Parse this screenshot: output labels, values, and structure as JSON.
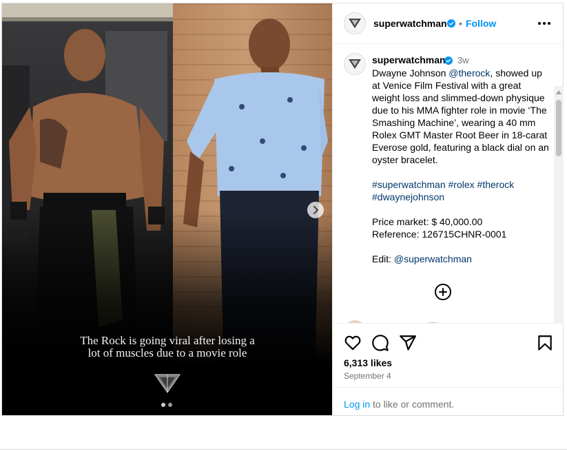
{
  "post": {
    "image_caption_lines": [
      "The Rock is going viral after losing a",
      "lot of muscles due to a movie role"
    ],
    "carousel": {
      "count": 2,
      "active_index": 0
    }
  },
  "header": {
    "username": "superwatchman",
    "separator": "•",
    "follow_label": "Follow"
  },
  "caption": {
    "username": "superwatchman",
    "time": "3w",
    "mention_therock": "@therock",
    "text_before_mention": "Dwayne Johnson ",
    "text_after_mention": ", showed up at Venice Film Festival with a great weight loss and slimmed-down physique due to his MMA fighter role in movie ‘The Smashing Machine’, wearing a 40 mm Rolex GMT Master Root Beer in 18-carat Everose gold, featuring a black dial on an oyster bracelet.",
    "hashtags": [
      "#superwatchman",
      "#rolex",
      "#therock",
      "#dwaynejohnson"
    ],
    "price_line": "Price market: $ 40,000.00",
    "reference_line": "Reference: 126715CHNR-0001",
    "edit_label": "Edit: ",
    "edit_mention": "@superwatchman"
  },
  "engagement": {
    "likes": "6,313 likes",
    "date": "September 4"
  },
  "login_prompt": {
    "link": "Log in",
    "rest": " to like or comment."
  },
  "colors": {
    "accent": "#0095f6",
    "link_dark": "#00376b",
    "muted": "#737373",
    "border": "#dbdbdb"
  }
}
